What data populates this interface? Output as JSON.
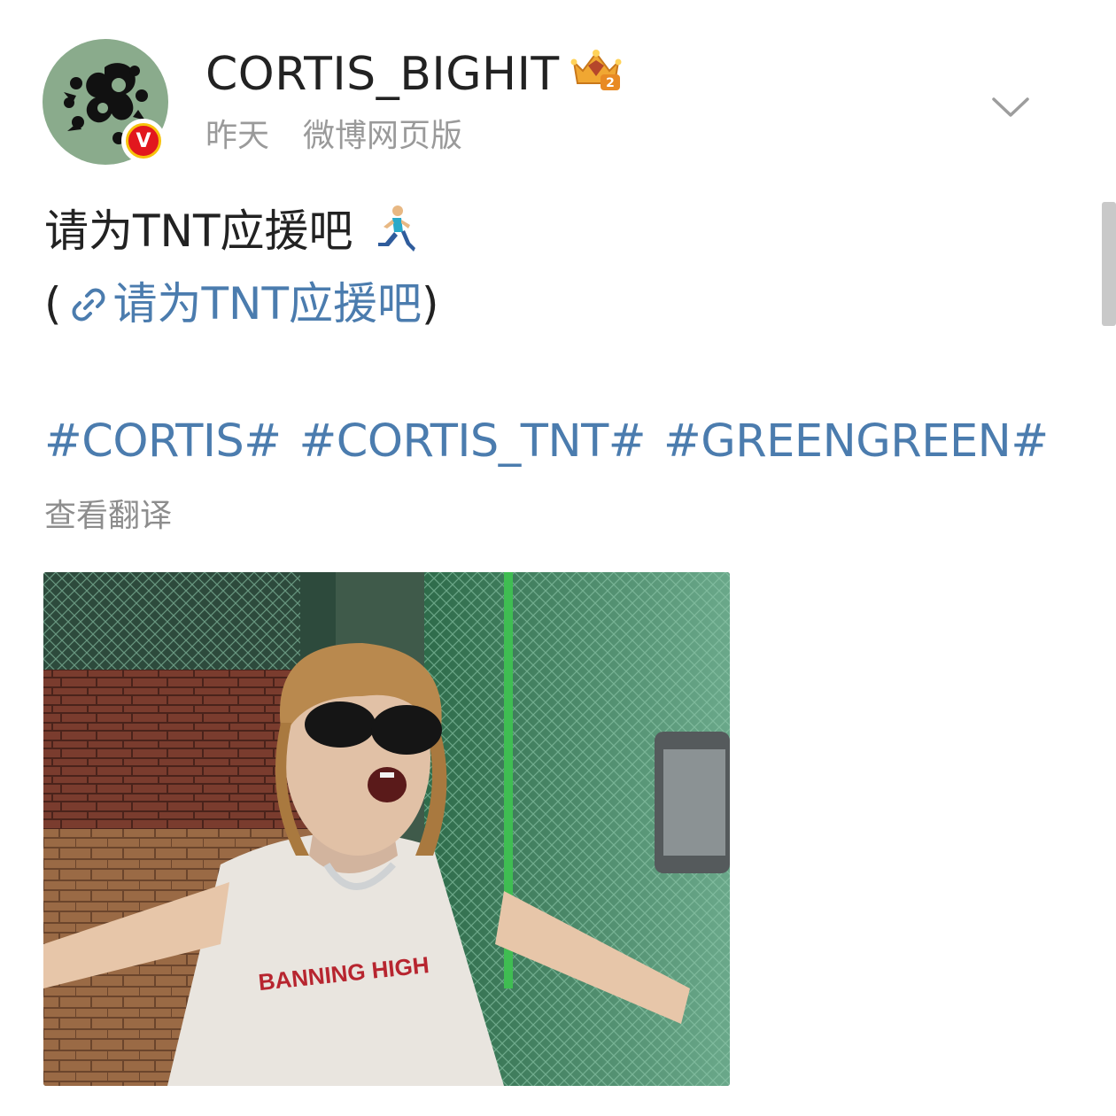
{
  "post": {
    "username": "CORTIS_BIGHIT",
    "level_badge": "2",
    "verified_badge": "V",
    "time": "昨天",
    "source": "微博网页版",
    "text_line": "请为TNT应援吧",
    "text_emoji": "runner-emoji",
    "link_open": "(",
    "link_text": "请为TNT应援吧",
    "link_close": ")",
    "hashtags": [
      "#CORTIS#",
      "#CORTIS_TNT#",
      "#GREENGREEN#"
    ],
    "translate_label": "查看翻译",
    "shirt_text": "BANNING HIGH"
  },
  "colors": {
    "link": "#4b7cae",
    "meta": "#9a9a9a",
    "text": "#222222",
    "avatar_bg": "#8aab8c",
    "verified_red": "#e2171e",
    "verified_ring": "#f7c20b"
  },
  "icons": [
    "chevron-down-icon",
    "link-icon",
    "crown-icon",
    "verified-icon"
  ]
}
